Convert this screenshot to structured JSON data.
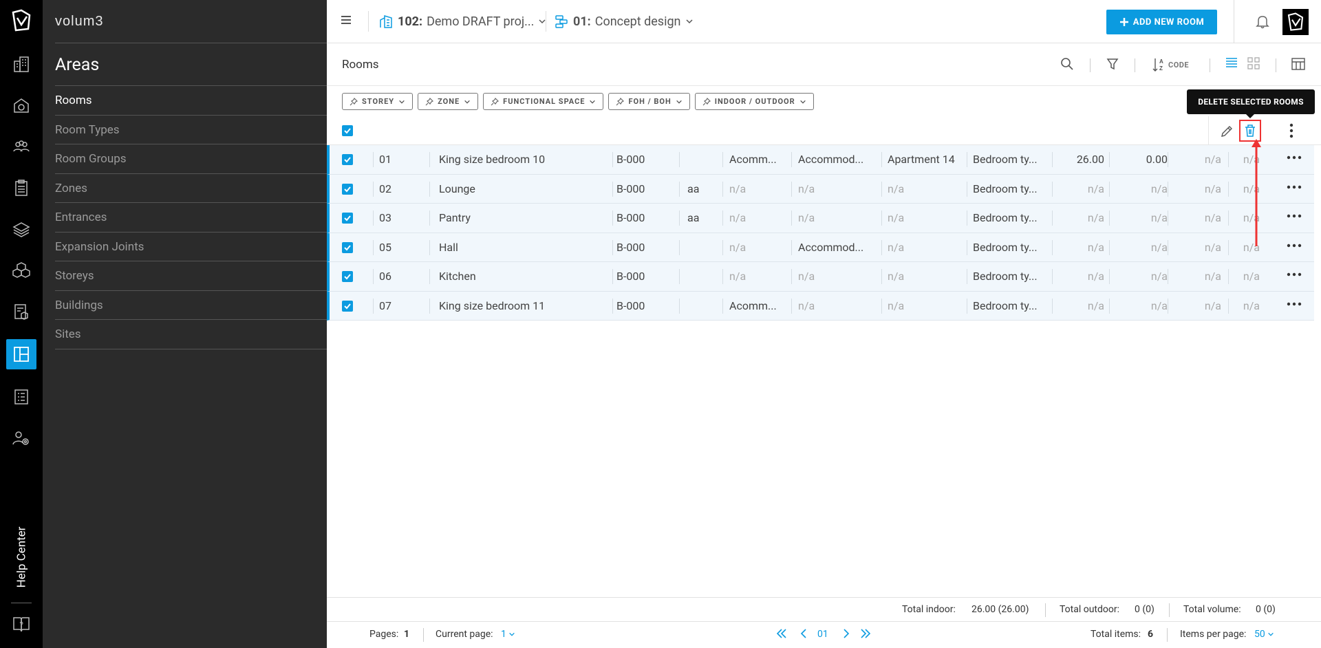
{
  "app": {
    "brand": "volum3"
  },
  "rail": {
    "items": [
      {
        "icon": "buildings-icon"
      },
      {
        "icon": "building-gear-icon"
      },
      {
        "icon": "users-icon"
      },
      {
        "icon": "clipboard-icon"
      },
      {
        "icon": "layers-icon"
      },
      {
        "icon": "cubes-icon"
      },
      {
        "icon": "document-cube-icon"
      },
      {
        "icon": "areas-icon",
        "active": true
      },
      {
        "icon": "spec-document-icon"
      },
      {
        "icon": "user-settings-icon"
      }
    ],
    "help_label": "Help Center"
  },
  "sidebar": {
    "title": "Areas",
    "items": [
      {
        "label": "Rooms",
        "active": true
      },
      {
        "label": "Room Types"
      },
      {
        "label": "Room Groups"
      },
      {
        "label": "Zones"
      },
      {
        "label": "Entrances"
      },
      {
        "label": "Expansion Joints"
      },
      {
        "label": "Storeys"
      },
      {
        "label": "Buildings"
      },
      {
        "label": "Sites"
      }
    ]
  },
  "topbar": {
    "project_code": "102:",
    "project_name": "Demo DRAFT proj...",
    "phase_code": "01:",
    "phase_name": "Concept design",
    "add_button": "ADD NEW ROOM"
  },
  "toolbar": {
    "title": "Rooms",
    "sort_label": "CODE"
  },
  "filters": [
    "STOREY",
    "ZONE",
    "FUNCTIONAL SPACE",
    "FOH / BOH",
    "INDOOR / OUTDOOR"
  ],
  "tooltip": "DELETE SELECTED ROOMS",
  "rows": [
    {
      "code": "01",
      "name": "King size bedroom 10",
      "storey": "B-000",
      "col4": "",
      "col5": "Acomm...",
      "col6": "Accommod...",
      "col7": "Apartment 14",
      "col8": "Bedroom ty...",
      "col9": "26.00",
      "col10": "0.00",
      "col11": "n/a",
      "col12": "n/a"
    },
    {
      "code": "02",
      "name": "Lounge",
      "storey": "B-000",
      "col4": "aa",
      "col5": "n/a",
      "col6": "n/a",
      "col7": "n/a",
      "col8": "Bedroom ty...",
      "col9": "n/a",
      "col10": "n/a",
      "col11": "n/a",
      "col12": "n/a"
    },
    {
      "code": "03",
      "name": "Pantry",
      "storey": "B-000",
      "col4": "aa",
      "col5": "n/a",
      "col6": "n/a",
      "col7": "n/a",
      "col8": "Bedroom ty...",
      "col9": "n/a",
      "col10": "n/a",
      "col11": "n/a",
      "col12": "n/a"
    },
    {
      "code": "05",
      "name": "Hall",
      "storey": "B-000",
      "col4": "",
      "col5": "n/a",
      "col6": "Accommod...",
      "col7": "n/a",
      "col8": "Bedroom ty...",
      "col9": "n/a",
      "col10": "n/a",
      "col11": "n/a",
      "col12": "n/a"
    },
    {
      "code": "06",
      "name": "Kitchen",
      "storey": "B-000",
      "col4": "",
      "col5": "n/a",
      "col6": "n/a",
      "col7": "n/a",
      "col8": "Bedroom ty...",
      "col9": "n/a",
      "col10": "n/a",
      "col11": "n/a",
      "col12": "n/a"
    },
    {
      "code": "07",
      "name": "King size bedroom 11",
      "storey": "B-000",
      "col4": "",
      "col5": "Acomm...",
      "col6": "n/a",
      "col7": "n/a",
      "col8": "Bedroom ty...",
      "col9": "n/a",
      "col10": "n/a",
      "col11": "n/a",
      "col12": "n/a"
    }
  ],
  "totals": {
    "indoor_label": "Total indoor:",
    "indoor_value": "26.00 (26.00)",
    "outdoor_label": "Total outdoor:",
    "outdoor_value": "0 (0)",
    "volume_label": "Total volume:",
    "volume_value": "0 (0)"
  },
  "pagination": {
    "pages_label": "Pages:",
    "pages_value": "1",
    "current_label": "Current page:",
    "current_value": "1",
    "page_number": "01",
    "total_items_label": "Total items:",
    "total_items_value": "6",
    "per_page_label": "Items per page:",
    "per_page_value": "50"
  },
  "colors": {
    "accent": "#0b9be0",
    "highlight": "#e33333",
    "rail_bg": "#000000",
    "sidebar_bg": "#2b2b2b"
  }
}
